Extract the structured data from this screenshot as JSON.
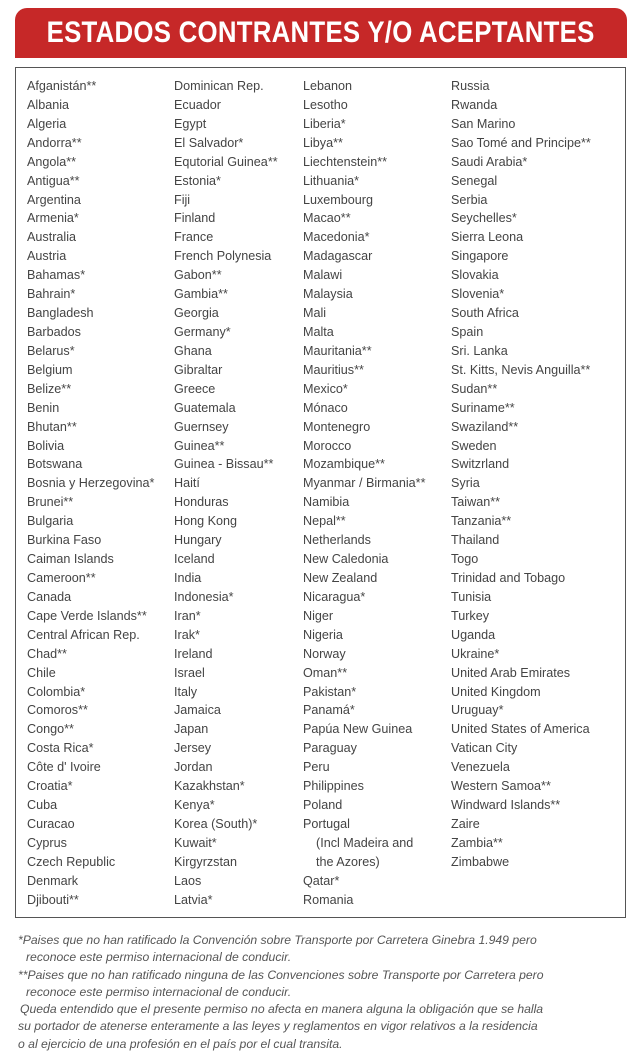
{
  "title": "ESTADOS CONTRANTES Y/O ACEPTANTES",
  "accent_color": "#c62828",
  "columns": [
    [
      "Afganistán**",
      "Albania",
      "Algeria",
      "Andorra**",
      "Angola**",
      "Antigua**",
      "Argentina",
      "Armenia*",
      "Australia",
      "Austria",
      "Bahamas*",
      "Bahrain*",
      "Bangladesh",
      "Barbados",
      "Belarus*",
      "Belgium",
      "Belize**",
      "Benin",
      "Bhutan**",
      "Bolivia",
      "Botswana",
      "Bosnia y Herzegovina*",
      "Brunei**",
      "Bulgaria",
      "Burkina Faso",
      "Caiman Islands",
      "Cameroon**",
      "Canada",
      "Cape Verde Islands**",
      "Central African Rep.",
      "Chad**",
      "Chile",
      "Colombia*",
      "Comoros**",
      "Congo**",
      "Costa Rica*",
      "Côte d' Ivoire",
      "Croatia*",
      "Cuba",
      "Curacao",
      "Cyprus",
      "Czech Republic",
      "Denmark",
      "Djibouti**"
    ],
    [
      "Dominican Rep.",
      "Ecuador",
      "Egypt",
      "El Salvador*",
      "Equtorial Guinea**",
      "Estonia*",
      "Fiji",
      "Finland",
      "France",
      "French Polynesia",
      "Gabon**",
      "Gambia**",
      "Georgia",
      "Germany*",
      "Ghana",
      "Gibraltar",
      "Greece",
      "Guatemala",
      "Guernsey",
      "Guinea**",
      "Guinea - Bissau**",
      "Haití",
      "Honduras",
      "Hong Kong",
      "Hungary",
      "Iceland",
      "India",
      "Indonesia*",
      "Iran*",
      "Irak*",
      "Ireland",
      "Israel",
      "Italy",
      "Jamaica",
      "Japan",
      "Jersey",
      "Jordan",
      "Kazakhstan*",
      "Kenya*",
      "Korea (South)*",
      "Kuwait*",
      "Kirgyrzstan",
      "Laos",
      "Latvia*"
    ],
    [
      "Lebanon",
      "Lesotho",
      "Liberia*",
      "Libya**",
      "Liechtenstein**",
      "Lithuania*",
      "Luxembourg",
      "Macao**",
      "Macedonia*",
      "Madagascar",
      "Malawi",
      "Malaysia",
      "Mali",
      "Malta",
      "Mauritania**",
      "Mauritius**",
      "Mexico*",
      "Mónaco",
      "Montenegro",
      "Morocco",
      "Mozambique**",
      "Myanmar / Birmania**",
      "Namibia",
      "Nepal**",
      "Netherlands",
      "New Caledonia",
      "New Zealand",
      "Nicaragua*",
      "Niger",
      "Nigeria",
      "Norway",
      "Oman**",
      "Pakistan*",
      "Panamá*",
      "Papúa New Guinea",
      "Paraguay",
      "Peru",
      "Philippines",
      "Poland",
      "Portugal",
      "(Incl Madeira and",
      "the Azores)",
      "Qatar*",
      "Romania"
    ],
    [
      "Russia",
      "Rwanda",
      "San Marino",
      "Sao Tomé and Principe**",
      "Saudi Arabia*",
      "Senegal",
      "Serbia",
      "Seychelles*",
      "Sierra Leona",
      "Singapore",
      "Slovakia",
      "Slovenia*",
      "South Africa",
      "Spain",
      "Sri. Lanka",
      "St. Kitts, Nevis Anguilla**",
      "Sudan**",
      "Suriname**",
      "Swaziland**",
      "Sweden",
      "Switzrland",
      "Syria",
      "Taiwan**",
      "Tanzania**",
      "Thailand",
      "Togo",
      "Trinidad and Tobago",
      "Tunisia",
      "Turkey",
      "Uganda",
      "Ukraine*",
      "United Arab Emirates",
      "United Kingdom",
      "Uruguay*",
      "United States of America",
      "Vatican City",
      "Venezuela",
      "Western Samoa**",
      "Windward Islands**",
      "Zaire",
      "Zambia**",
      "Zimbabwe"
    ]
  ],
  "notes": [
    "*Paises que no han ratificado la Convención sobre Transporte por Carretera Ginebra 1.949 pero",
    "reconoce este permiso internacional de conducir.",
    "**Paises que no han ratificado ninguna de las Convenciones sobre Transporte por Carretera  pero",
    "reconoce este permiso internacional de conducir.",
    "Queda entendido que el presente permiso no afecta en manera alguna la obligación que se halla",
    "su portador de atenerse enteramente a las leyes y reglamentos en vigor relativos a la residencia",
    "o al ejercicio de una profesión en el país por el cual transita."
  ]
}
